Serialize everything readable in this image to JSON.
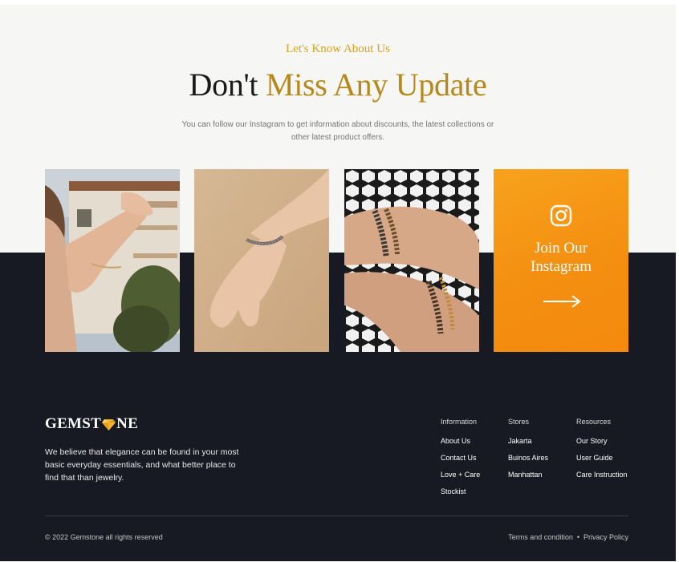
{
  "hero": {
    "eyebrow": "Let's Know About Us",
    "headline_part1": "Don't ",
    "headline_part2": "Miss Any Update",
    "subtitle": "You can follow our Instagram to get information about discounts, the latest collections or other latest product offers."
  },
  "instagram": {
    "title_line1": "Join Our",
    "title_line2": "Instagram",
    "icon": "instagram-icon",
    "arrow_icon": "arrow-right-icon",
    "tile_color": "#f59a16"
  },
  "gallery": {
    "photos": [
      "woman-with-bracelet-photo",
      "hand-with-bracelet-photo",
      "beaded-bracelets-photo"
    ]
  },
  "footer": {
    "brand_left": "GEMST",
    "brand_right": "NE",
    "brand_icon": "diamond-icon",
    "about": "We believe that elegance can be found in your most basic everyday essentials, and what better place to find that than jewelry.",
    "columns": [
      {
        "heading": "Information",
        "links": [
          "About Us",
          "Contact Us",
          "Love + Care",
          "Stockist"
        ]
      },
      {
        "heading": "Stores",
        "links": [
          "Jakarta",
          "Buinos Aires",
          "Manhattan"
        ]
      },
      {
        "heading": "Resources",
        "links": [
          "Our Story",
          "User Guide",
          "Care Instruction"
        ]
      }
    ],
    "copyright": "© 2022 Gemstone all rights reserved",
    "terms": "Terms and condition",
    "separator": "•",
    "privacy": "Privacy Policy"
  },
  "colors": {
    "accent_gold": "#d9a21c",
    "dark_bg": "#171a22",
    "light_bg": "#f6f6f5"
  }
}
